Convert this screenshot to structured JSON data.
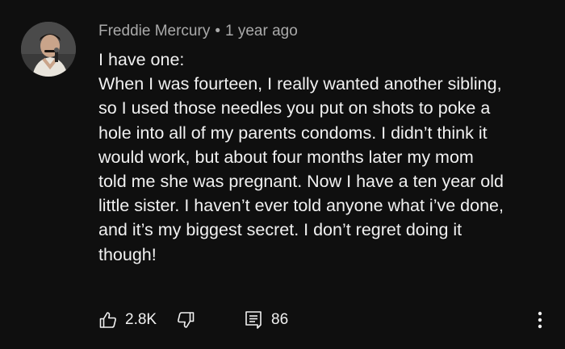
{
  "comment": {
    "author": "Freddie Mercury",
    "separator": "•",
    "timestamp": "1 year ago",
    "lines": [
      "I have one:",
      "When I was fourteen, I really wanted another sibling,",
      "so I used those needles you put on shots to poke a",
      "hole into all of my parents condoms. I didn’t think it",
      "would work, but about four months later my mom",
      "told me she was pregnant. Now I have a ten year old",
      "little sister. I haven’t ever told anyone what i’ve done,",
      "and it’s my biggest secret. I don’t regret doing it",
      "though!"
    ]
  },
  "actions": {
    "like_count": "2.8K",
    "reply_count": "86"
  },
  "icons": {
    "like": "thumbs-up-icon",
    "dislike": "thumbs-down-icon",
    "replies": "comment-replies-icon",
    "more": "more-vertical-icon"
  },
  "colors": {
    "background": "#0f0f0f",
    "text": "#f1f1f1",
    "meta": "#aaaaaa"
  }
}
